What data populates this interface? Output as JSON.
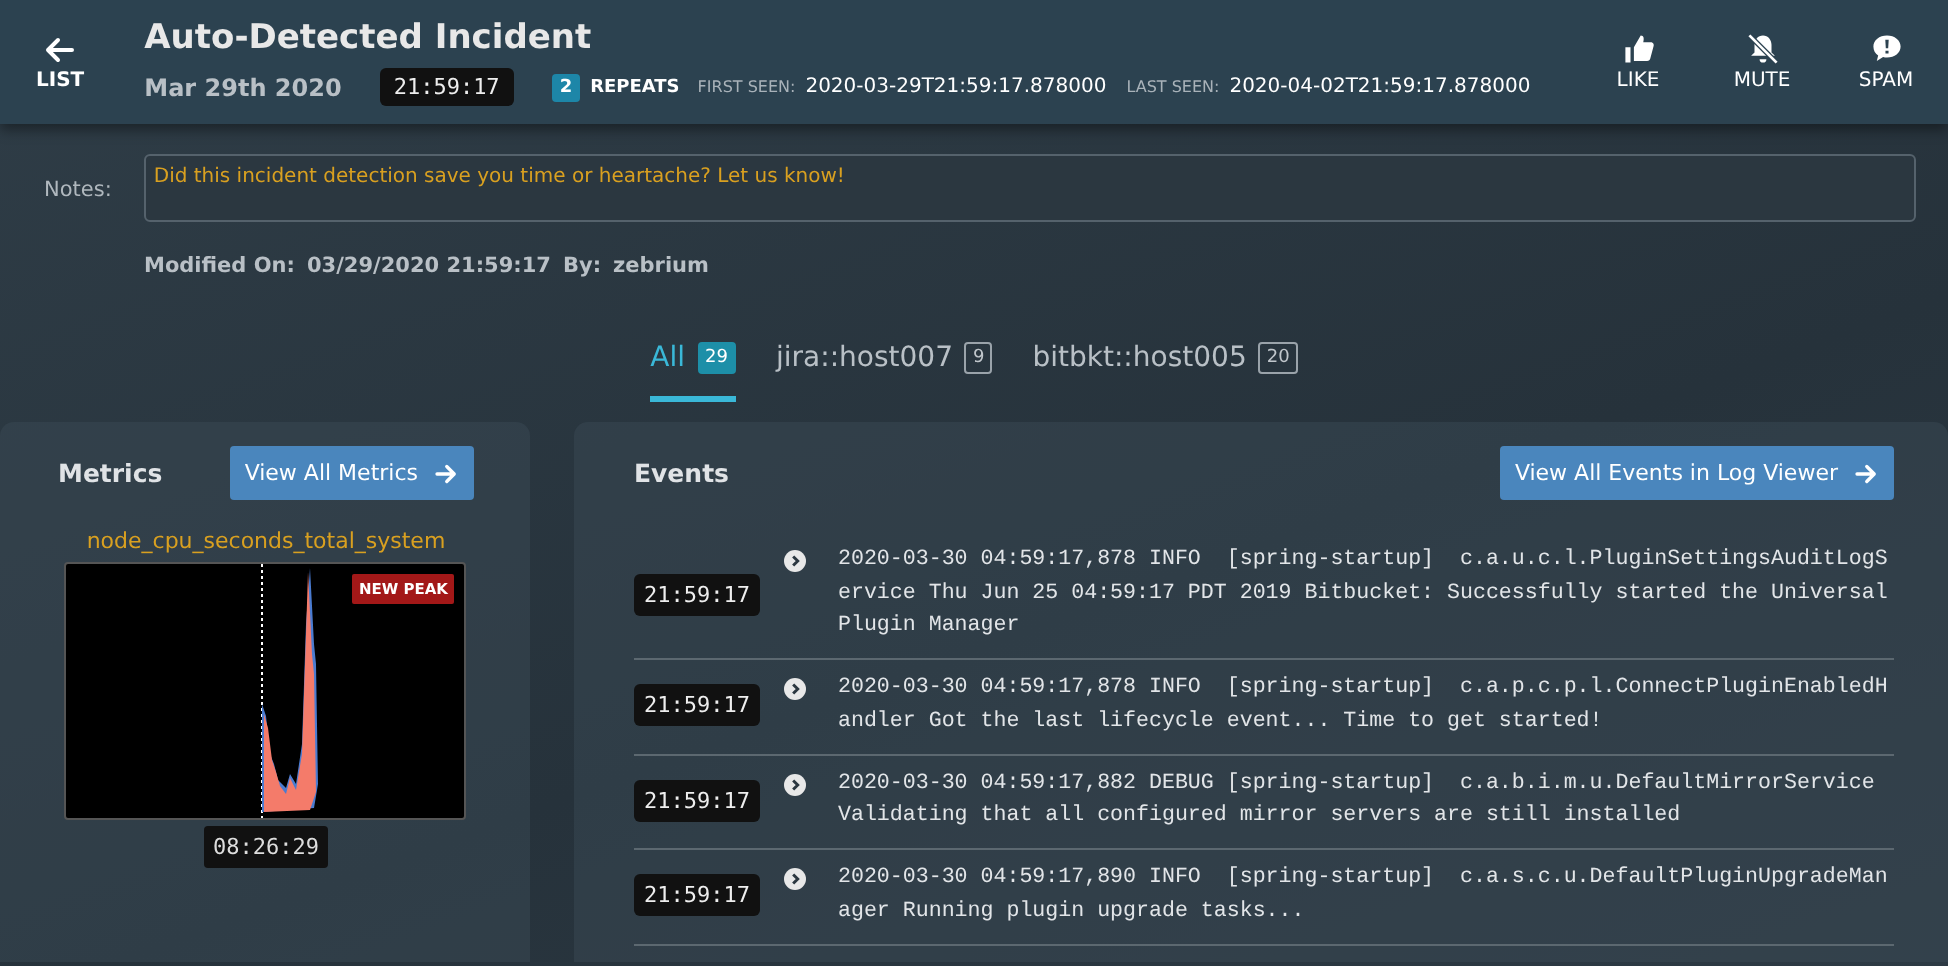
{
  "header": {
    "back_label": "LIST",
    "title": "Auto-Detected Incident",
    "date": "Mar 29th 2020",
    "time": "21:59:17",
    "repeats_count": "2",
    "repeats_label": "REPEATS",
    "first_seen_label": "FIRST SEEN:",
    "first_seen": "2020-03-29T21:59:17.878000",
    "last_seen_label": "LAST SEEN:",
    "last_seen": "2020-04-02T21:59:17.878000",
    "actions": [
      {
        "kind": "like",
        "label": "LIKE"
      },
      {
        "kind": "mute",
        "label": "MUTE"
      },
      {
        "kind": "spam",
        "label": "SPAM"
      }
    ]
  },
  "notes": {
    "label": "Notes:",
    "value": "Did this incident detection save you time or heartache? Let us know!"
  },
  "modified": {
    "label": "Modified On:",
    "value": "03/29/2020 21:59:17",
    "by_label": "By:",
    "by": "zebrium"
  },
  "tabs": [
    {
      "label": "All",
      "count": "29",
      "selected": true
    },
    {
      "label": "jira::host007",
      "count": "9",
      "selected": false
    },
    {
      "label": "bitbkt::host005",
      "count": "20",
      "selected": false
    }
  ],
  "metrics": {
    "title": "Metrics",
    "button": "View All Metrics",
    "chart_title": "node_cpu_seconds_total_system",
    "badge": "NEW PEAK",
    "time": "08:26:29"
  },
  "events": {
    "title": "Events",
    "button": "View All Events in Log Viewer",
    "items": [
      {
        "time": "21:59:17",
        "text": "2020-03-30 04:59:17,878 INFO  [spring-startup]  c.a.u.c.l.PluginSettingsAuditLogService Thu Jun 25 04:59:17 PDT 2019 Bitbucket: Successfully started the Universal Plugin Manager"
      },
      {
        "time": "21:59:17",
        "text": "2020-03-30 04:59:17,878 INFO  [spring-startup]  c.a.p.c.p.l.ConnectPluginEnabledHandler Got the last lifecycle event... Time to get started!"
      },
      {
        "time": "21:59:17",
        "text": "2020-03-30 04:59:17,882 DEBUG [spring-startup]  c.a.b.i.m.u.DefaultMirrorService Validating that all configured mirror servers are still installed"
      },
      {
        "time": "21:59:17",
        "text": "2020-03-30 04:59:17,890 INFO  [spring-startup]  c.a.s.c.u.DefaultPluginUpgradeManager Running plugin upgrade tasks..."
      }
    ]
  }
}
